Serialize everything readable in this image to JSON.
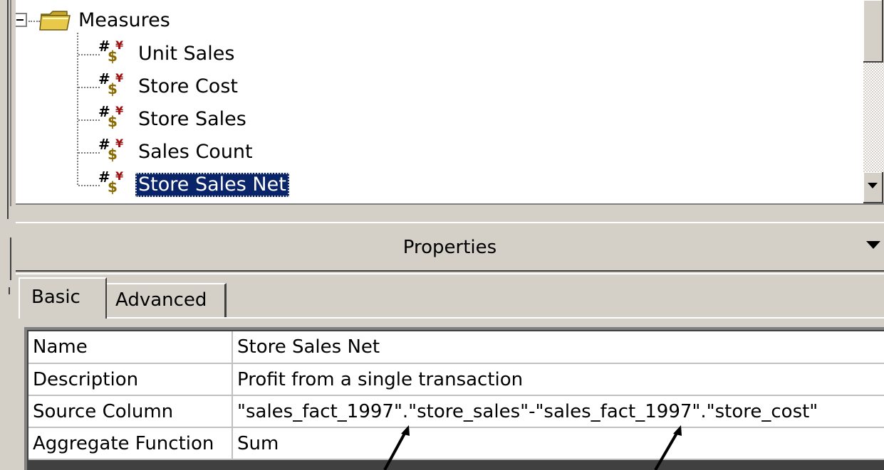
{
  "tree": {
    "root": {
      "label": "Measures",
      "expanded": true
    },
    "measures": [
      {
        "label": "Unit Sales"
      },
      {
        "label": "Store Cost"
      },
      {
        "label": "Store Sales"
      },
      {
        "label": "Sales Count"
      },
      {
        "label": "Store Sales Net",
        "selected": true
      }
    ]
  },
  "properties": {
    "title": "Properties",
    "tabs": [
      {
        "label": "Basic",
        "active": true
      },
      {
        "label": "Advanced",
        "active": false
      }
    ],
    "rows": [
      {
        "key": "Name",
        "value": "Store Sales Net"
      },
      {
        "key": "Description",
        "value": "Profit from a single transaction"
      },
      {
        "key": "Source Column",
        "value": "\"sales_fact_1997\".\"store_sales\"-\"sales_fact_1997\".\"store_cost\""
      },
      {
        "key": "Aggregate Function",
        "value": "Sum"
      }
    ]
  },
  "icons": {
    "expand_toggle": "minus-box-icon",
    "folder": "folder-icon",
    "measure": "measure-icon",
    "collapse": "triangle-down-icon",
    "scroll_down": "scroll-down-arrow-icon"
  },
  "colors": {
    "window_bg": "#d4d0c8",
    "selection": "#0a246a",
    "folder": "#e8c94a",
    "measure_icon": "#8a6a00"
  }
}
